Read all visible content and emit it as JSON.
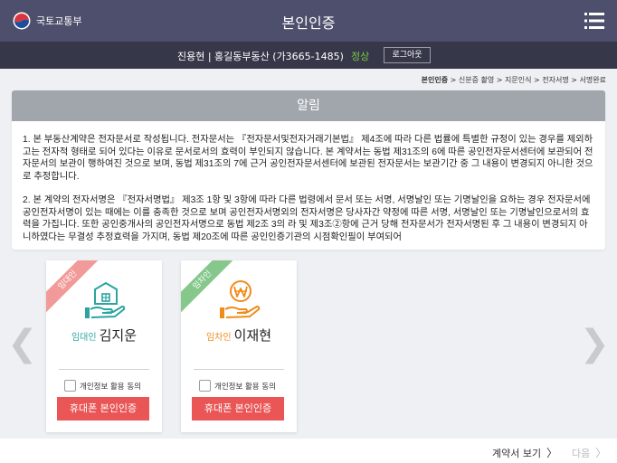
{
  "header": {
    "org_name": "국토교통부",
    "title": "본인인증",
    "menu_icon": "hamburger-menu-icon"
  },
  "userbar": {
    "user_info": "진용현 | 홍길동부동산 (가3665-1485)",
    "status": "정상",
    "logout_label": "로그아웃"
  },
  "breadcrumb": {
    "current": "본인인증",
    "steps": [
      "신분증 촬영",
      "지문인식",
      "전자서명",
      "서명완료"
    ],
    "separator": ">"
  },
  "notice": {
    "title": "알림",
    "paragraphs": [
      "1. 본 부동산계약은 전자문서로 작성됩니다. 전자문서는 『전자문서및전자거래기본법』 제4조에 따라 다른 법률에 특별한 규정이 있는 경우를 제외하고는 전자적 형태로 되어 있다는 이유로 문서로서의 효력이 부인되지 않습니다. 본 계약서는 동법 제31조의 6에 따른 공인전자문서센터에 보관되어 전자문서의 보관이 행하여진 것으로 보며, 동법 제31조의 7에 근거 공인전자문서센터에 보관된 전자문서는 보관기간 중 그 내용이 변경되지 아니한 것으로 추정합니다.",
      "2. 본 계약의 전자서명은 『전자서명법』 제3조 1항 및 3항에 따라 다른 법령에서 문서 또는 서명, 서명날인 또는 기명날인을 요하는 경우 전자문서에 공인전자서명이 있는 때에는 이를 충족한 것으로 보며 공인전자서명외의 전자서명은 당사자간 약정에 따른 서명, 서명날인 또는 기명날인으로서의 효력을 가집니다. 또한 공인중개사의 공인전자서명으로 동법 제2조 3의 라 및 제3조②항에 근거 당해 전자문서가 전자서명된 후 그 내용이 변경되지 아니하였다는 무결성 추정효력을 가지며, 동법 제20조에 따른 공인인증기관의 시점확인필이 부여되어"
    ]
  },
  "nav": {
    "prev_icon": "chevron-left-icon",
    "next_icon": "chevron-right-icon"
  },
  "cards": [
    {
      "ribbon": "임대인",
      "ribbon_color": "#f29a9a",
      "icon": "house-hand-icon",
      "role": "임대인",
      "role_color": "#2aa5a0",
      "name": "김지운",
      "consent_label": "개인정보 활용 동의",
      "consent_checked": false,
      "button_label": "휴대폰 본인인증"
    },
    {
      "ribbon": "임차인",
      "ribbon_color": "#86c78c",
      "icon": "won-coin-hand-icon",
      "role": "임차인",
      "role_color": "#f08c1a",
      "name": "이재현",
      "consent_label": "개인정보 활용 동의",
      "consent_checked": false,
      "button_label": "휴대폰 본인인증"
    }
  ],
  "footer": {
    "view_contract_label": "계약서 보기",
    "next_label": "다음"
  },
  "colors": {
    "header_bg": "#4e4f6c",
    "userbar_bg": "#363749",
    "status_green": "#7ac943",
    "notice_head": "#a1a6ad",
    "button_red": "#ea5656"
  }
}
